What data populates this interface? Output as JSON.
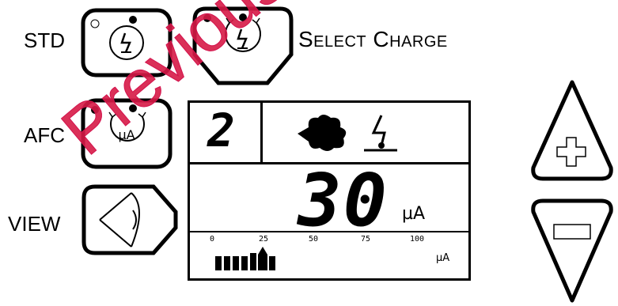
{
  "labels": {
    "std": "STD",
    "afc": "AFC",
    "view": "VIEW",
    "select_charge": "Select Charge"
  },
  "display": {
    "mode_number": "2",
    "value": "30",
    "unit": "µA",
    "bar_unit": "µA",
    "ticks": [
      "0",
      "25",
      "50",
      "75",
      "100"
    ],
    "level_marker": "25",
    "bar_level_percent": 25
  },
  "watermark": "Previous Generation",
  "colors": {
    "watermark": "#d4124d",
    "ink": "#000000"
  },
  "icons": {
    "std": "lightning-bolt-circle-icon",
    "select_charge": "lightning-bolt-circle-icon",
    "afc": "microamp-circle-icon",
    "view": "eye-icon",
    "plus": "plus-icon",
    "minus": "minus-icon",
    "cloud": "cloud-icon",
    "ground_bolt": "lightning-ground-icon"
  }
}
